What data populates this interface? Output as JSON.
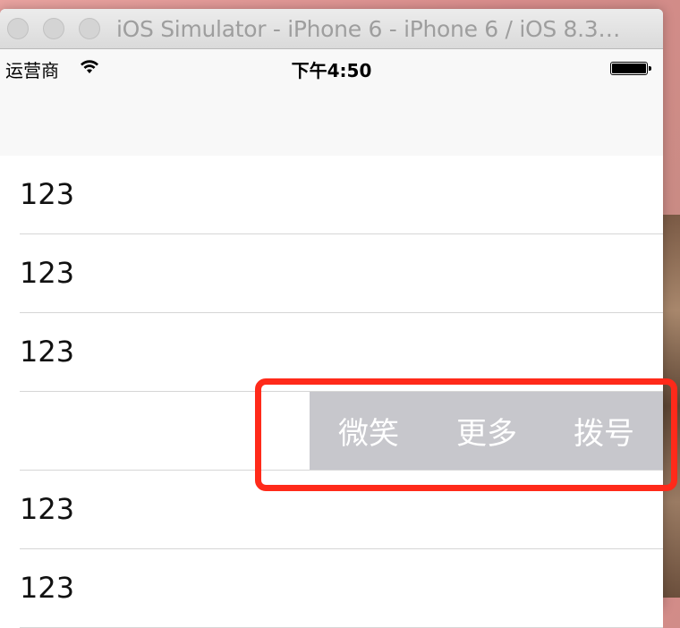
{
  "window": {
    "title": "iOS Simulator - iPhone 6 - iPhone 6 / iOS 8.3…"
  },
  "status_bar": {
    "carrier": "运营商",
    "time": "下午4:50",
    "signal_icon": "wifi-icon",
    "battery_icon": "battery-icon"
  },
  "table": {
    "rows": [
      {
        "label": "123"
      },
      {
        "label": "123"
      },
      {
        "label": "123"
      },
      {
        "label": ""
      },
      {
        "label": "123"
      },
      {
        "label": "123"
      }
    ],
    "swipe_actions": [
      "微笑",
      "更多",
      "拨号"
    ]
  },
  "colors": {
    "action_background": "#c7c7cc",
    "highlight_border": "#ff2a1a"
  }
}
